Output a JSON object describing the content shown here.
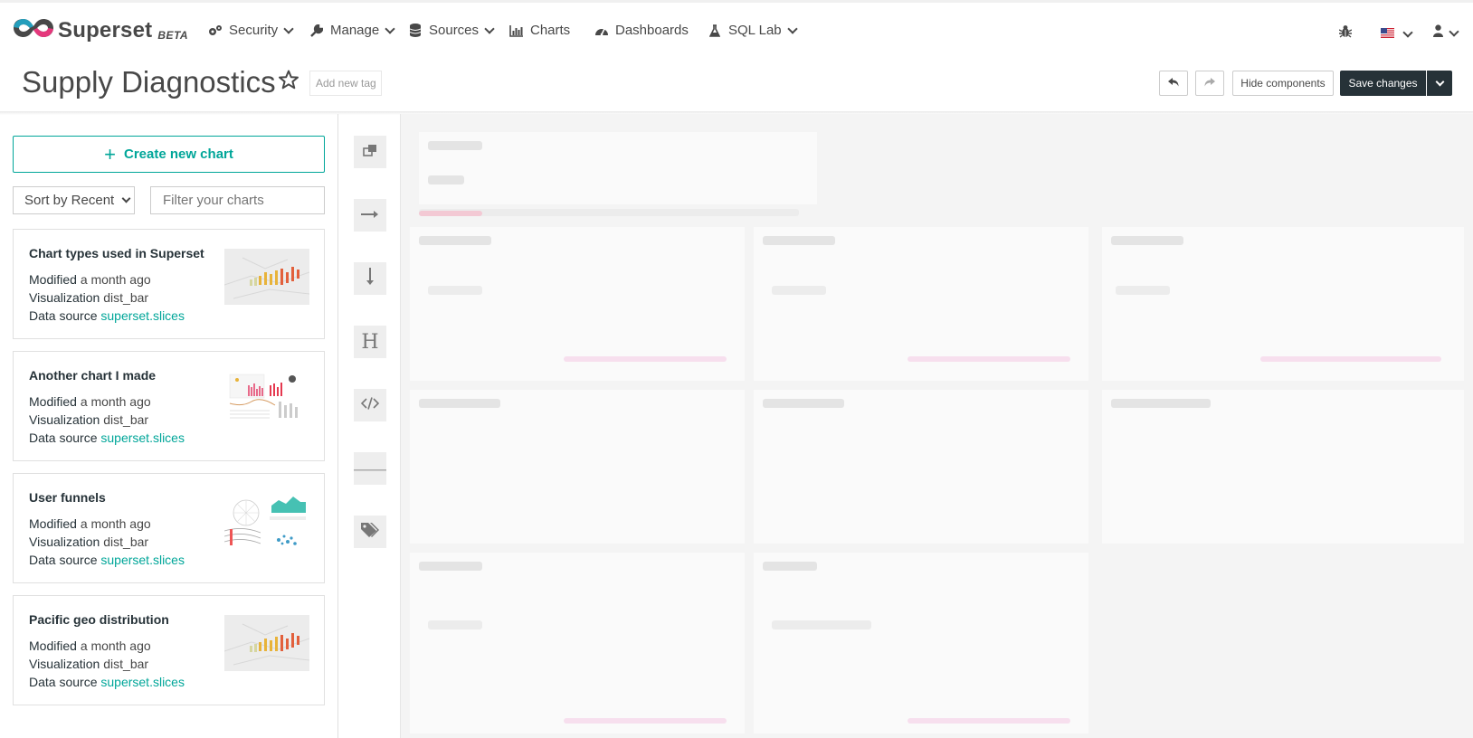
{
  "brand": {
    "name": "Superset",
    "badge": "BETA"
  },
  "nav": {
    "items": [
      {
        "label": "Security",
        "icon": "cogs-icon",
        "dropdown": true
      },
      {
        "label": "Manage",
        "icon": "wrench-icon",
        "dropdown": true
      },
      {
        "label": "Sources",
        "icon": "database-icon",
        "dropdown": true
      },
      {
        "label": "Charts",
        "icon": "bar-chart-icon",
        "dropdown": false
      },
      {
        "label": "Dashboards",
        "icon": "dashboard-icon",
        "dropdown": false
      },
      {
        "label": "SQL Lab",
        "icon": "flask-icon",
        "dropdown": true
      }
    ],
    "right_icons": [
      "bug-icon",
      "us-flag-icon",
      "user-icon"
    ]
  },
  "header": {
    "title": "Supply Diagnostics",
    "tag_placeholder": "Add new tag",
    "undo_icon": "undo-icon",
    "redo_icon": "redo-icon",
    "hide_components_label": "Hide components",
    "save_label": "Save changes"
  },
  "sidebar": {
    "create_label": "Create new chart",
    "sort_label": "Sort by Recent",
    "filter_placeholder": "Filter your charts",
    "field_labels": {
      "modified": "Modified",
      "visualization": "Visualization",
      "datasource": "Data source"
    },
    "charts": [
      {
        "title": "Chart types used in Superset",
        "modified": "a month ago",
        "viz": "dist_bar",
        "datasource": "superset.slices",
        "thumb": "map-bars"
      },
      {
        "title": "Another chart I made",
        "modified": "a month ago",
        "viz": "dist_bar",
        "datasource": "superset.slices",
        "thumb": "dashboard"
      },
      {
        "title": "User funnels",
        "modified": "a month ago",
        "viz": "dist_bar",
        "datasource": "superset.slices",
        "thumb": "mixed"
      },
      {
        "title": "Pacific geo distribution",
        "modified": "a month ago",
        "viz": "dist_bar",
        "datasource": "superset.slices",
        "thumb": "map-bars"
      }
    ]
  },
  "toolbox": [
    "tabs-icon",
    "row-icon",
    "column-icon",
    "header-icon",
    "markdown-icon",
    "divider-icon",
    "tags-icon"
  ],
  "colors": {
    "accent": "#00a699",
    "dark": "#263238",
    "text": "#484848"
  }
}
